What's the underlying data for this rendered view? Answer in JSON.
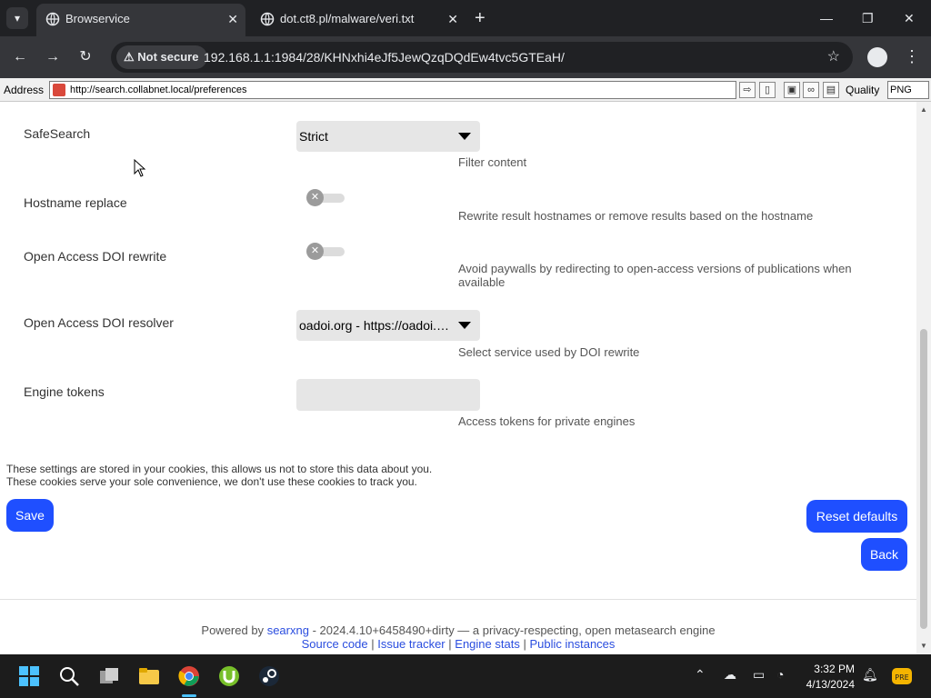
{
  "browser": {
    "tabs": [
      {
        "title": "Browservice",
        "active": true
      },
      {
        "title": "dot.ct8.pl/malware/veri.txt",
        "active": false
      }
    ],
    "security_label": "Not secure",
    "url": "192.168.1.1:1984/28/KHNxhi4eJf5JewQzqDQdEw4tvc5GTEaH/"
  },
  "inner_toolbar": {
    "address_label": "Address",
    "address_value": "http://search.collabnet.local/preferences",
    "quality_label": "Quality",
    "quality_value": "PNG"
  },
  "settings": {
    "safesearch": {
      "label": "SafeSearch",
      "value": "Strict",
      "desc": "Filter content"
    },
    "hostname_replace": {
      "label": "Hostname replace",
      "desc": "Rewrite result hostnames or remove results based on the hostname"
    },
    "oa_doi_rewrite": {
      "label": "Open Access DOI rewrite",
      "desc_line1": "Avoid paywalls by redirecting to open-access versions of publications when",
      "desc_line2": "available"
    },
    "oa_doi_resolver": {
      "label": "Open Access DOI resolver",
      "value": "oadoi.org - https://oadoi.org/",
      "desc": "Select service used by DOI rewrite"
    },
    "engine_tokens": {
      "label": "Engine tokens",
      "value": "",
      "desc": "Access tokens for private engines"
    }
  },
  "cookie_note": {
    "line1": "These settings are stored in your cookies, this allows us not to store this data about you.",
    "line2": "These cookies serve your sole convenience, we don't use these cookies to track you."
  },
  "buttons": {
    "save": "Save",
    "reset": "Reset defaults",
    "back": "Back"
  },
  "footer": {
    "powered_prefix": "Powered by",
    "searxng": "searxng",
    "powered_suffix": "- 2024.4.10+6458490+dirty — a privacy-respecting, open metasearch engine",
    "links": [
      "Source code",
      "Issue tracker",
      "Engine stats",
      "Public instances"
    ],
    "sep": "|"
  },
  "taskbar": {
    "time": "3:32 PM",
    "date": "4/13/2024"
  }
}
